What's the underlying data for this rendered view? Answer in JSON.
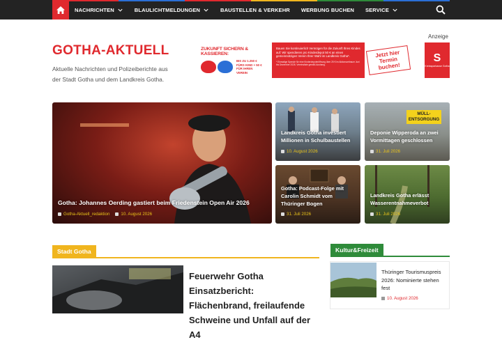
{
  "colors": {
    "brand_red": "#e0292e",
    "topbar": "#232323",
    "culture_green": "#2e8b3a",
    "city_yellow": "#f0b51e"
  },
  "nav": {
    "home_icon": "home-icon",
    "items": [
      {
        "label": "NACHRICHTEN",
        "has_dropdown": true
      },
      {
        "label": "BLAULICHTMELDUNGEN",
        "has_dropdown": true
      },
      {
        "label": "BAUSTELLEN & VERKEHR",
        "has_dropdown": false
      },
      {
        "label": "WERBUNG BUCHEN",
        "has_dropdown": false
      },
      {
        "label": "SERVICE",
        "has_dropdown": true
      }
    ],
    "search_icon": "search-icon"
  },
  "site": {
    "title": "GOTHA-AKTUELL",
    "tagline": "Aktuelle Nachrichten und Polizeiberichte aus der Stadt Gotha und dem Landkreis Gotha."
  },
  "ad": {
    "label": "Anzeige",
    "headline": "ZUKUNFT SICHERN & KASSIEREN:",
    "bonus": "BIS ZU 1.250 € FÜRS KIND + 50 € FÜR IHREN VEREIN",
    "body": "Bauen Sie kontinuierlich Vermögen für die Zukunft Ihres Kindes auf: Wir spendieren pro Kinderdepot 50 € an einen gemeinnützigen Verein Ihrer Wahl im Landkreis Gotha*.",
    "footnote": "* Einmalige Spende für eine Kinderdepoteröffnung über 25 € im Aktionszeitraum Juni bis Dezember 2026. Vereinsliste gemäß Aushang.",
    "cta": "Jetzt hier Termin buchen!",
    "bank_logo": "S",
    "bank_name": "Kreissparkasse Gotha"
  },
  "hero": {
    "title": "Gotha: Johannes Oerding gastiert beim Friedenstein Open Air 2026",
    "author": "Gotha-Aktuell_redaktion",
    "date": "10. August 2026"
  },
  "grid": [
    {
      "title": "Landkreis Gotha investiert Millionen in Schulbaustellen",
      "date": "10. August 2026"
    },
    {
      "title": "Deponie Wipperoda an zwei Vormittagen geschlossen",
      "date": "31. Juli 2026",
      "badge": "MÜLL-ENTSORGUNG"
    },
    {
      "title": "Gotha: Podcast-Folge mit Carolin Schmidt vom Thüringer Bogen",
      "date": "31. Juli 2026"
    },
    {
      "title": "Landkreis Gotha erlässt Wasserentnahmeverbot",
      "date": "31. Juli 2026"
    }
  ],
  "sections": {
    "city": "Stadt Gotha",
    "culture": "Kultur&Freizeit"
  },
  "featured": {
    "title": "Feuerwehr Gotha Einsatzbericht: Flächenbrand, freilaufende Schweine und Unfall auf der A4"
  },
  "culture_post": {
    "title": "Thüringer Tourismuspreis 2026: Nominierte stehen fest",
    "date": "10. August 2026"
  }
}
